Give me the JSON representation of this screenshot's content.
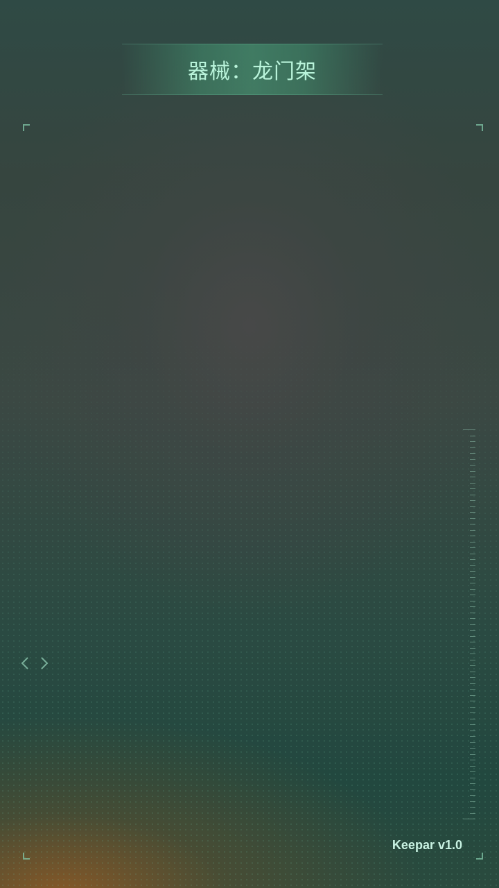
{
  "header": {
    "title": "器械：龙门架"
  },
  "navigation": {
    "prev_icon": "chevron-left-icon",
    "next_icon": "chevron-right-icon"
  },
  "footer": {
    "version": "Keepar v1.0"
  },
  "colors": {
    "accent": "#b9f3da",
    "frame": "#82c8aa"
  }
}
